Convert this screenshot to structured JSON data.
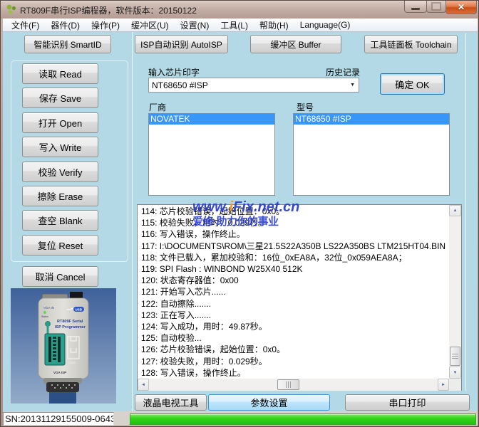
{
  "window": {
    "title": "RT809F串行ISP编程器，软件版本：20150122"
  },
  "icons": {
    "close": "✕",
    "dropdown": "▼",
    "scroll_up": "▲",
    "scroll_down": "▼",
    "scroll_left": "◄",
    "scroll_right": "►"
  },
  "menu": [
    {
      "label": "文件(F)",
      "name": "menu-file"
    },
    {
      "label": "器件(D)",
      "name": "menu-device"
    },
    {
      "label": "操作(P)",
      "name": "menu-operate"
    },
    {
      "label": "缓冲区(U)",
      "name": "menu-buffer"
    },
    {
      "label": "设置(N)",
      "name": "menu-settings"
    },
    {
      "label": "工具(L)",
      "name": "menu-tools"
    },
    {
      "label": "帮助(H)",
      "name": "menu-help"
    },
    {
      "label": "Language(G)",
      "name": "menu-language"
    }
  ],
  "top_buttons": [
    {
      "label": "智能识别 SmartID",
      "name": "smartid-button"
    },
    {
      "label": "ISP自动识别 AutoISP",
      "name": "autoisp-button"
    },
    {
      "label": "缓冲区 Buffer",
      "name": "buffer-button"
    },
    {
      "label": "工具链面板 Toolchain",
      "name": "toolchain-button"
    }
  ],
  "side_buttons": [
    {
      "label": "读取 Read",
      "name": "read-button"
    },
    {
      "label": "保存 Save",
      "name": "save-button"
    },
    {
      "label": "打开 Open",
      "name": "open-button"
    },
    {
      "label": "写入 Write",
      "name": "write-button"
    },
    {
      "label": "校验 Verify",
      "name": "verify-button"
    },
    {
      "label": "擦除 Erase",
      "name": "erase-button"
    },
    {
      "label": "查空 Blank",
      "name": "blank-button"
    },
    {
      "label": "复位 Reset",
      "name": "reset-button"
    }
  ],
  "cancel_button": "取消 Cancel",
  "chip_input": {
    "label": "输入芯片印字",
    "history_label": "历史记录",
    "value": "NT68650 #ISP",
    "ok_button": "确定 OK"
  },
  "manufacturer": {
    "label": "厂商",
    "items": [
      {
        "label": "NOVATEK",
        "selected": true
      }
    ]
  },
  "model": {
    "label": "型号",
    "items": [
      {
        "label": "NT68650 #ISP",
        "selected": true
      }
    ]
  },
  "log": {
    "lines": [
      "114: 芯片校验错误，起始位置：0x0。",
      "115: 校验失败，用时：0.029秒。",
      "116: 写入错误，操作终止。",
      "117: I:\\DOCUMENTS\\ROM\\三星21.5S22A350B LS22A350BS LTM215HT04.BIN",
      "118: 文件已载入，累加校验和：16位_0xEA8A，32位_0x059AEA8A；",
      "119: SPI Flash : WINBOND W25X40 512K",
      "120: 状态寄存器值：0x00",
      "121: 开始写入芯片......",
      "122: 自动擦除.......",
      "123: 正在写入.......",
      "124: 写入成功，用时：49.87秒。",
      "125: 自动校验...",
      "126: 芯片校验错误，起始位置：0x0。",
      "127: 校验失败，用时：0.029秒。",
      "128: 写入错误，操作终止。"
    ]
  },
  "watermark": {
    "part1": "www.",
    "accent": "i",
    "part2": "Fix.net.cn",
    "line2": "爱修·助力你的事业"
  },
  "bottom_buttons": {
    "lcd_tv_tools": "液晶电视工具",
    "param_settings": "参数设置",
    "serial_print": "串口打印"
  },
  "status": {
    "serial_number": "SN:20131129155009-0643"
  },
  "photo_labels": {
    "vga_in": "VGA IN",
    "status_led": "Status",
    "title1": "RT809F Serial",
    "title2": "ISP Programmer",
    "usb": "USB",
    "hdmi": "HDMI",
    "vga_isp": "VGA ISP"
  },
  "colors": {
    "selection_blue": "#3796f7",
    "progress_green": "#35d41e",
    "watermark_blue": "#2b3fd0",
    "watermark_orange": "#f7941d"
  }
}
